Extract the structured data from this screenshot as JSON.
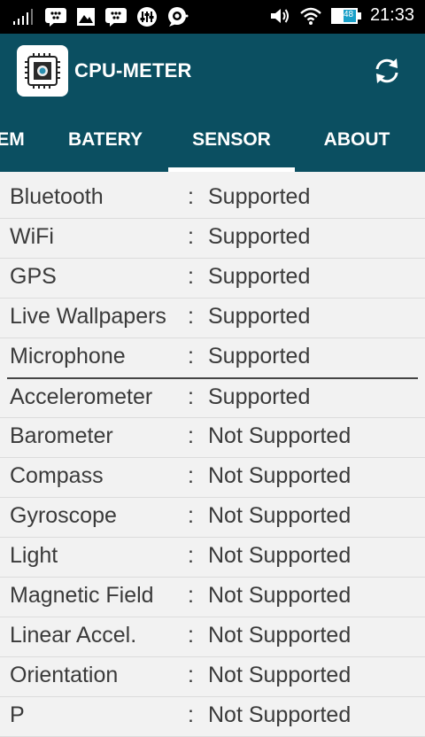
{
  "status_bar": {
    "time": "21:33",
    "battery_level": "48",
    "icons": [
      "signal-icon",
      "bbm-icon",
      "gallery-icon",
      "bbm-icon",
      "equalizer-icon",
      "message-icon",
      "volume-icon",
      "wifi-icon",
      "battery-icon"
    ]
  },
  "app_bar": {
    "title": "CPU-METER",
    "icon": "cpu-icon",
    "refresh_icon": "refresh-icon"
  },
  "tabs": [
    {
      "label": "EM",
      "selected": false
    },
    {
      "label": "BATERY",
      "selected": false
    },
    {
      "label": "SENSOR",
      "selected": true
    },
    {
      "label": "ABOUT",
      "selected": false
    }
  ],
  "separator": ":",
  "features": [
    {
      "label": "Bluetooth",
      "value": "Supported"
    },
    {
      "label": "WiFi",
      "value": "Supported"
    },
    {
      "label": "GPS",
      "value": "Supported"
    },
    {
      "label": "Live Wallpapers",
      "value": "Supported"
    },
    {
      "label": "Microphone",
      "value": "Supported"
    }
  ],
  "sensors": [
    {
      "label": "Accelerometer",
      "value": "Supported"
    },
    {
      "label": "Barometer",
      "value": "Not Supported"
    },
    {
      "label": "Compass",
      "value": "Not Supported"
    },
    {
      "label": "Gyroscope",
      "value": "Not Supported"
    },
    {
      "label": "Light",
      "value": "Not Supported"
    },
    {
      "label": "Magnetic Field",
      "value": "Not Supported"
    },
    {
      "label": "Linear Accel.",
      "value": "Not Supported"
    },
    {
      "label": "Orientation",
      "value": "Not Supported"
    },
    {
      "label": "P",
      "value": "Not Supported"
    }
  ],
  "colors": {
    "app_bar": "#0b4f61",
    "list_background": "#f2f2f2",
    "text": "#3a3a3a"
  }
}
